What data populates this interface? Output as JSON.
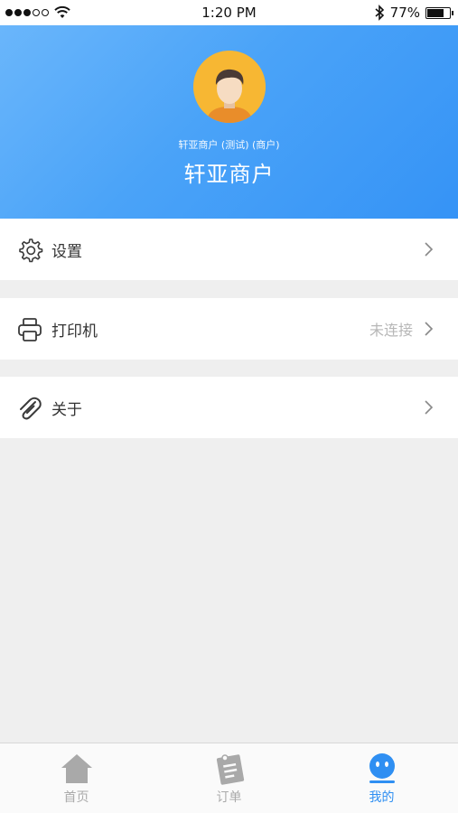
{
  "status_bar": {
    "time": "1:20 PM",
    "battery": "77%",
    "battery_level": 0.77,
    "icons": [
      "signal-dots-icon",
      "wifi-icon",
      "bluetooth-icon",
      "battery-icon"
    ]
  },
  "profile": {
    "subtitle": "轩亚商户 (测试) (商户)",
    "name": "轩亚商户",
    "avatar_icon": "user-avatar-icon"
  },
  "menu": {
    "settings": {
      "label": "设置",
      "icon": "gear-icon"
    },
    "printer": {
      "label": "打印机",
      "value": "未连接",
      "icon": "printer-icon"
    },
    "about": {
      "label": "关于",
      "icon": "paperclip-icon"
    }
  },
  "tabs": [
    {
      "label": "首页",
      "icon": "home-icon",
      "active": false
    },
    {
      "label": "订单",
      "icon": "order-icon",
      "active": false
    },
    {
      "label": "我的",
      "icon": "profile-face-icon",
      "active": true
    }
  ],
  "colors": {
    "accent": "#2f8ff2",
    "header_gradient_start": "#6ab6fb",
    "header_gradient_end": "#3593f6",
    "avatar_bg": "#f7b733",
    "background": "#efefef"
  }
}
